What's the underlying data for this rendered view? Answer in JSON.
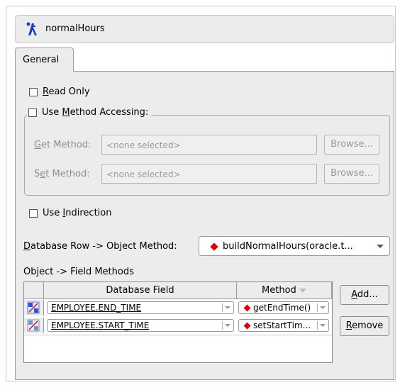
{
  "header": {
    "title": "normalHours",
    "icon": "direct-to-field-mapping-icon"
  },
  "tabs": [
    {
      "label": "General"
    }
  ],
  "read_only": {
    "label_u": "R",
    "label_rest": "ead Only",
    "checked": false
  },
  "use_method_accessing": {
    "label_pre": "Use ",
    "label_u": "M",
    "label_rest": "ethod Accessing:",
    "checked": false
  },
  "get_method": {
    "label_u": "G",
    "label_rest": "et Method:",
    "value": "<none selected>",
    "browse_label": "Browse..."
  },
  "set_method": {
    "label_pre": "S",
    "label_u": "e",
    "label_rest": "t Method:",
    "value": "<none selected>",
    "browse_label": "Browse..."
  },
  "use_indirection": {
    "label_pre": "Use ",
    "label_u": "I",
    "label_rest": "ndirection",
    "checked": false
  },
  "db_row_method": {
    "label_u": "D",
    "label_rest": "atabase Row -> Object Method:",
    "value": "buildNormalHours(oracle.t..."
  },
  "field_methods": {
    "label": "Object -> Field Methods",
    "columns": [
      "Database Field",
      "Method"
    ],
    "rows": [
      {
        "field": "EMPLOYEE.END_TIME",
        "method": "getEndTime()"
      },
      {
        "field": "EMPLOYEE.START_TIME",
        "method": "setStartTim..."
      }
    ],
    "add_label_u": "A",
    "add_label_rest": "dd...",
    "remove_label_u": "R",
    "remove_label_rest": "emove"
  },
  "colors": {
    "panel_bg": "#ececec",
    "method_diamond": "#e00000",
    "disabled_text": "#8e8e8e"
  }
}
